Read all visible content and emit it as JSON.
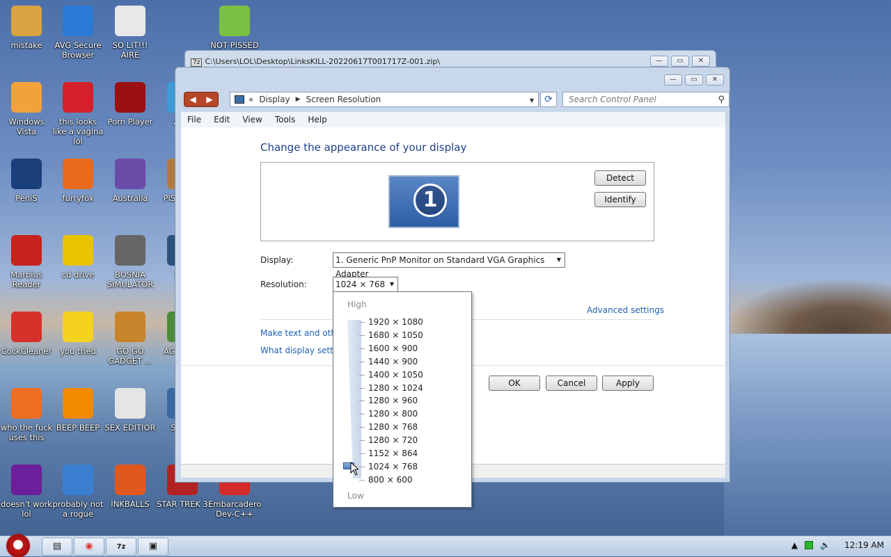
{
  "desktop": {
    "icons": [
      {
        "label": "mistake",
        "icon": "folder-image-icon",
        "color": "#d9a441"
      },
      {
        "label": "AVG Secure Browser",
        "icon": "avg-browser-icon",
        "color": "#2a7ad6"
      },
      {
        "label": "SO LIT!!! AIRE",
        "icon": "card-game-icon",
        "color": "#e8e8e8"
      },
      {
        "label": "NOT PISSED",
        "icon": "angry-pig-icon",
        "color": "#7ac143"
      },
      {
        "label": "Windows Vista",
        "icon": "egg-icon",
        "color": "#f2a23b"
      },
      {
        "label": "this looks like a vagina lol",
        "icon": "opera-icon",
        "color": "#d4202a"
      },
      {
        "label": "Porn Player",
        "icon": "flash-icon",
        "color": "#9b1010"
      },
      {
        "label": "ANG",
        "icon": "app-icon",
        "color": "#3c9ad6"
      },
      {
        "label": "PeniS",
        "icon": "photoshop-icon",
        "color": "#1b3f7a"
      },
      {
        "label": "furryfox",
        "icon": "firefox-icon",
        "color": "#e86a1c"
      },
      {
        "label": "Australia",
        "icon": "spider-icon",
        "color": "#6a4ba8"
      },
      {
        "label": "PISS AVIA",
        "icon": "app-icon",
        "color": "#b07a42"
      },
      {
        "label": "Marbius Reader",
        "icon": "pdf-icon",
        "color": "#c8231e"
      },
      {
        "label": "cd drive",
        "icon": "cd-icon",
        "color": "#e8c400"
      },
      {
        "label": "BOSNIA SIMULATOR",
        "icon": "mine-icon",
        "color": "#666666"
      },
      {
        "label": "M U",
        "icon": "app-icon",
        "color": "#2c4f7c"
      },
      {
        "label": "CockCleaner",
        "icon": "ccleaner-icon",
        "color": "#d7322a"
      },
      {
        "label": "you tried",
        "icon": "star-icon",
        "color": "#f5d21e"
      },
      {
        "label": "GO GO GADGET ...",
        "icon": "briefcase-icon",
        "color": "#c8852b"
      },
      {
        "label": "AGC CHO",
        "icon": "app-icon",
        "color": "#4a8a3a"
      },
      {
        "label": "who the fuck uses this",
        "icon": "lightning-icon",
        "color": "#ef6d22"
      },
      {
        "label": "BEEP BEEP",
        "icon": "vlc-icon",
        "color": "#f28a00"
      },
      {
        "label": "SEX EDITIOR",
        "icon": "hxd-icon",
        "color": "#e5e5e5"
      },
      {
        "label": "STA G",
        "icon": "app-icon",
        "color": "#3a6aa0"
      },
      {
        "label": "doesn't work lol",
        "icon": "yahoo-icon",
        "color": "#6b1f9a"
      },
      {
        "label": "probably not a rogue",
        "icon": "gears-icon",
        "color": "#3b7fd1"
      },
      {
        "label": "INKBALLS",
        "icon": "inkball-icon",
        "color": "#e0581e"
      },
      {
        "label": "STAR TREK 3",
        "icon": "startrek-icon",
        "color": "#b22222"
      },
      {
        "label": "Embarcadero Dev-C++",
        "icon": "devcpp-icon",
        "color": "#d42a2a"
      }
    ]
  },
  "bg_window": {
    "title": "C:\\Users\\LOL\\Desktop\\LinksKILL-20220617T001717Z-001.zip\\",
    "app_icon": "7z"
  },
  "window": {
    "breadcrumb_prefix": "«",
    "breadcrumb": [
      "Display",
      "Screen Resolution"
    ],
    "search_placeholder": "Search Control Panel",
    "menu": [
      "File",
      "Edit",
      "View",
      "Tools",
      "Help"
    ],
    "heading": "Change the appearance of your display",
    "monitor_number": "1",
    "detect_label": "Detect",
    "identify_label": "Identify",
    "display_label": "Display:",
    "display_value": "1. Generic PnP Monitor on Standard VGA Graphics Adapter",
    "resolution_label": "Resolution:",
    "resolution_value": "1024 × 768",
    "advanced_link": "Advanced settings",
    "link_text_size": "Make text and other",
    "link_display_settings": "What display setting",
    "ok_label": "OK",
    "cancel_label": "Cancel",
    "apply_label": "Apply"
  },
  "resolution_popup": {
    "high_label": "High",
    "low_label": "Low",
    "options": [
      "1920 × 1080",
      "1680 × 1050",
      "1600 × 900",
      "1440 × 900",
      "1400 × 1050",
      "1280 × 1024",
      "1280 × 960",
      "1280 × 800",
      "1280 × 768",
      "1280 × 720",
      "1152 × 864",
      "1024 × 768",
      "800 × 600"
    ],
    "selected": "1024 × 768"
  },
  "taskbar": {
    "clock": "12:19 AM",
    "items": [
      "explorer",
      "chrome",
      "7z",
      "control-panel"
    ]
  },
  "colors": {
    "link": "#1e5fb4",
    "heading": "#1e3f8a",
    "nav_button": "#b6462a"
  }
}
